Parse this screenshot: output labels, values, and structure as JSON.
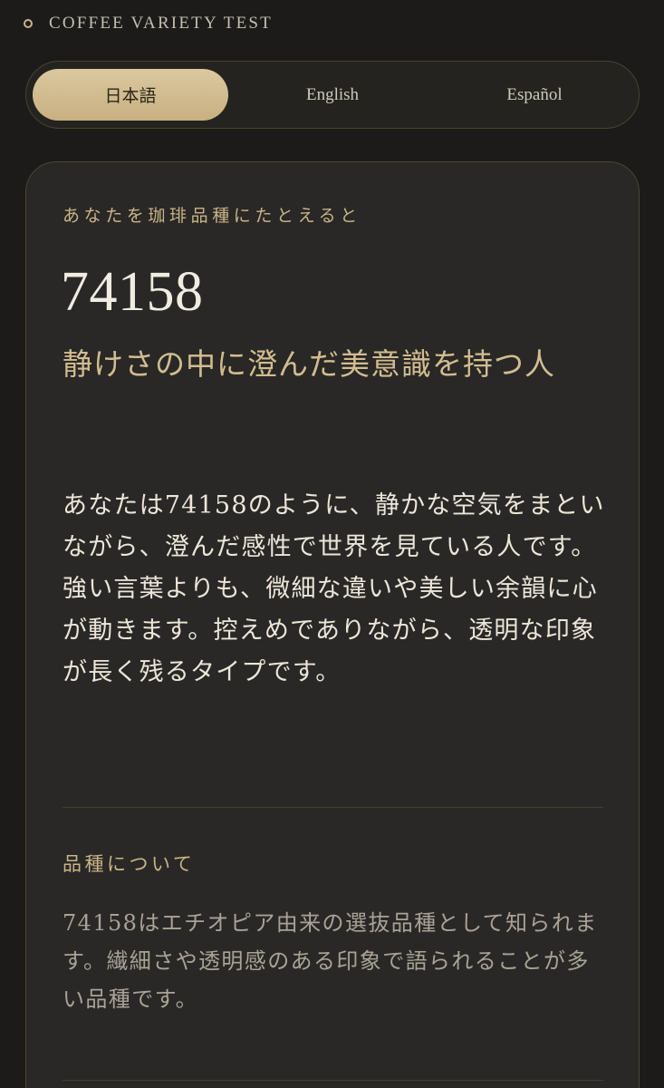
{
  "header": {
    "title": "COFFEE VARIETY TEST"
  },
  "language_switcher": {
    "tabs": [
      {
        "label": "日本語",
        "active": true
      },
      {
        "label": "English",
        "active": false
      },
      {
        "label": "Español",
        "active": false
      }
    ]
  },
  "result": {
    "eyebrow": "あなたを珈琲品種にたとえると",
    "variety_number": "74158",
    "headline": "静けさの中に澄んだ美意識を持つ人",
    "description": "あなたは74158のように、静かな空気をまといながら、澄んだ感性で世界を見ている人です。強い言葉よりも、微細な違いや美しい余韻に心が動きます。控えめでありながら、透明な印象が長く残るタイプです。"
  },
  "about_variety": {
    "heading": "品種について",
    "body": "74158はエチオピア由来の選抜品種として知られます。繊細さや透明感のある印象で語られることが多い品種です。"
  },
  "colors": {
    "background": "#1c1b19",
    "card": "#292826",
    "accent_gold": "#c9b486",
    "active_tab": "#d6c398"
  }
}
